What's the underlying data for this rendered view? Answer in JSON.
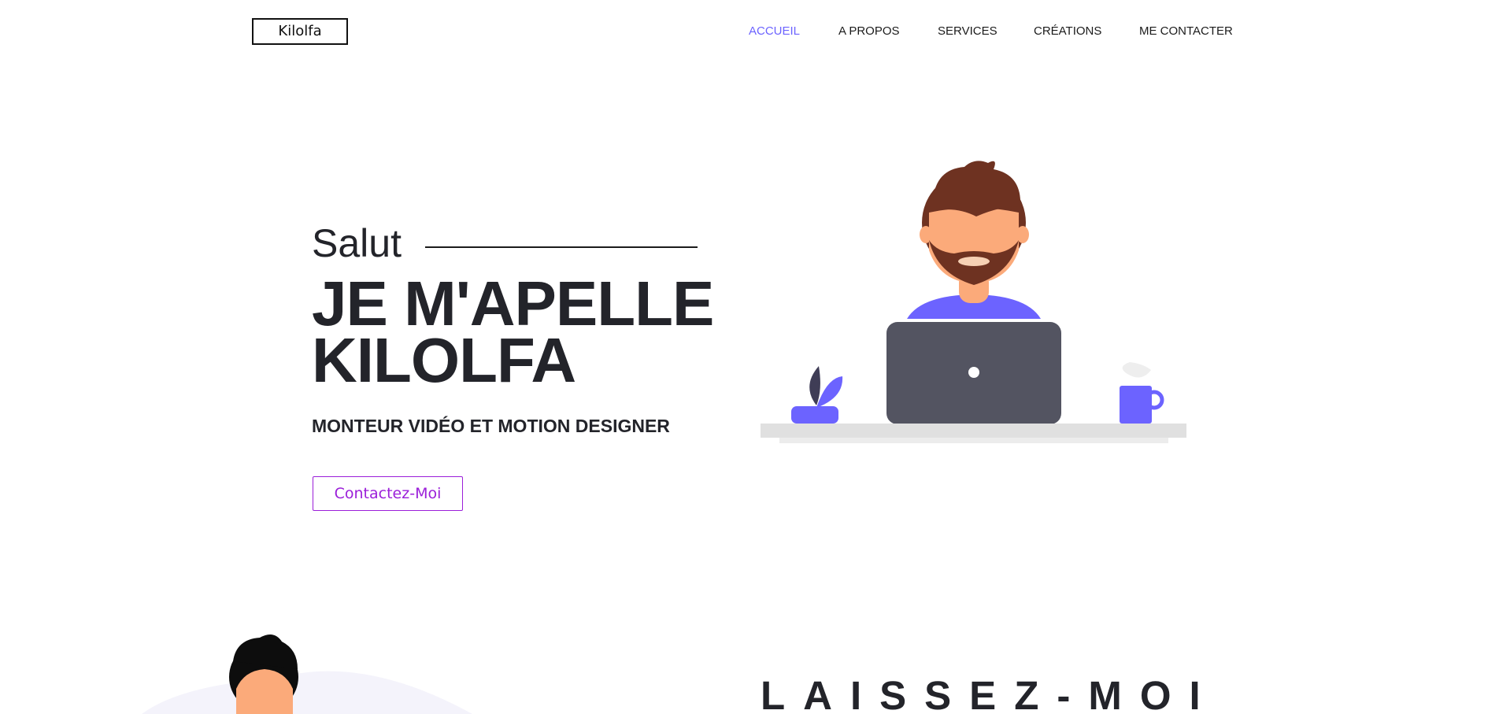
{
  "header": {
    "logo": "Kilolfa",
    "nav": [
      {
        "label": "ACCUEIL",
        "active": true
      },
      {
        "label": "A PROPOS",
        "active": false
      },
      {
        "label": "SERVICES",
        "active": false
      },
      {
        "label": "CRÉATIONS",
        "active": false
      },
      {
        "label": "ME CONTACTER",
        "active": false
      }
    ]
  },
  "hero": {
    "greeting": "Salut",
    "title_line1": "JE M'APELLE",
    "title_line2": "KILOLFA",
    "subtitle": "MONTEUR VIDÉO ET MOTION DESIGNER",
    "cta_label": "Contactez-Moi"
  },
  "next_section": {
    "title": "LAISSEZ-MOI"
  },
  "colors": {
    "accent": "#6c63ff",
    "button": "#9b1fd9",
    "text": "#23242a",
    "laptop": "#535461",
    "hair": "#6e3221",
    "skin": "#fbaa7a"
  },
  "icons": {
    "hero": "man-at-laptop-illustration",
    "plant": "plant-icon",
    "mug": "coffee-mug-icon",
    "avatar": "avatar-illustration"
  }
}
